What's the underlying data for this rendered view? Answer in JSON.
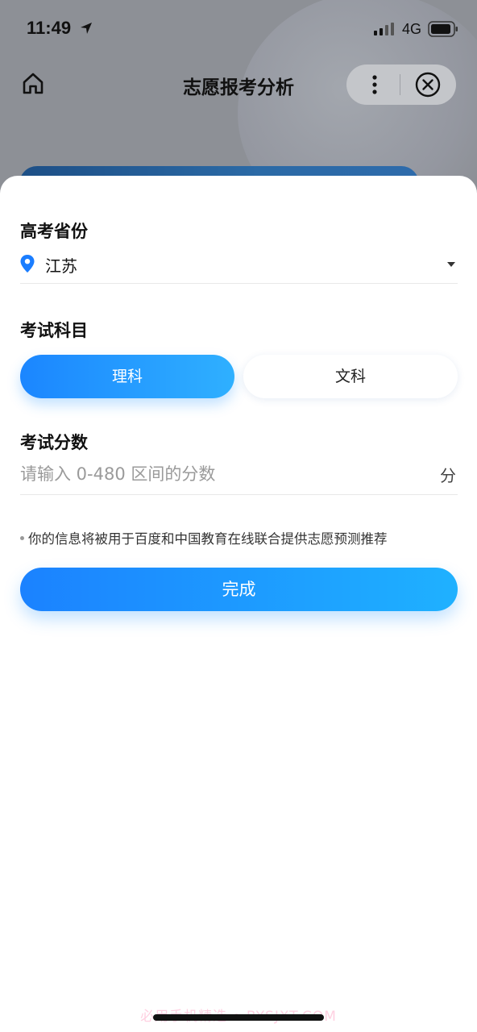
{
  "status_bar": {
    "time": "11:49",
    "network": "4G"
  },
  "nav": {
    "title": "志愿报考分析"
  },
  "form": {
    "province_label": "高考省份",
    "province_value": "江苏",
    "subject_label": "考试科目",
    "subject_options": [
      "理科",
      "文科"
    ],
    "subject_selected": "理科",
    "score_label": "考试分数",
    "score_placeholder": "请输入 0-480 区间的分数",
    "score_unit": "分",
    "notice": "你的信息将被用于百度和中国教育在线联合提供志愿预测推荐",
    "submit_label": "完成"
  },
  "watermark": "必用手机精选 • BYSJXT.COM",
  "colors": {
    "primary_gradient_start": "#1b82ff",
    "primary_gradient_end": "#1fb1ff",
    "location_pin": "#1a7dff",
    "overlay": "#8d9096"
  }
}
